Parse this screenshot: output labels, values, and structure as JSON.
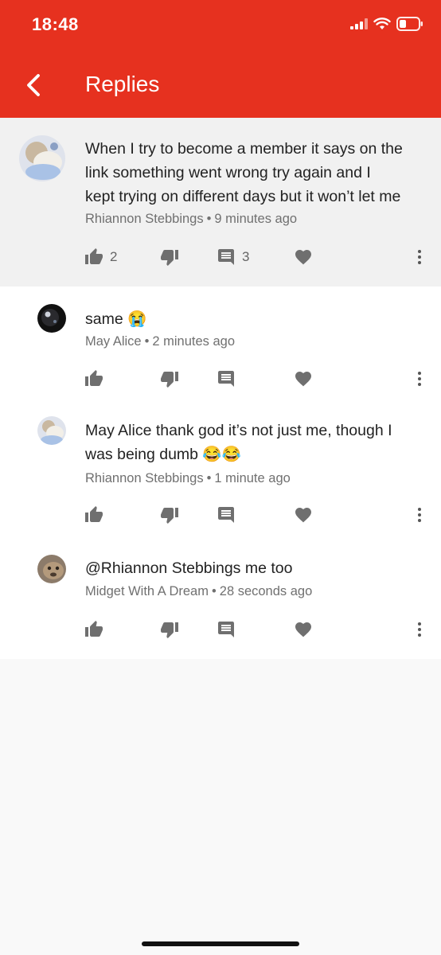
{
  "status_bar": {
    "time": "18:48"
  },
  "header": {
    "title": "Replies",
    "color": "#e6311f"
  },
  "parent_comment": {
    "text_lines": [
      "When I try to become a member it says on the",
      "link something went wrong try again and I",
      "kept trying on different days but it won’t let me"
    ],
    "author": "Rhiannon Stebbings",
    "separator": "•",
    "time": "9 minutes ago",
    "like_count": "2",
    "reply_count": "3"
  },
  "replies": [
    {
      "text_lines": [
        "same 😭"
      ],
      "author": "May Alice",
      "separator": "•",
      "time": "2 minutes ago"
    },
    {
      "text_lines": [
        "May Alice thank god it’s not just me, though I",
        "was being dumb 😂😂"
      ],
      "author": "Rhiannon Stebbings",
      "separator": "•",
      "time": "1 minute ago"
    },
    {
      "text_lines": [
        "@Rhiannon Stebbings me too"
      ],
      "author": "Midget With A Dream",
      "separator": "•",
      "time": "28 seconds ago"
    }
  ],
  "icons": [
    "back-arrow-icon",
    "signal-icon",
    "wifi-icon",
    "battery-icon",
    "thumbs-up-icon",
    "thumbs-down-icon",
    "comment-icon",
    "heart-icon",
    "more-vert-icon"
  ]
}
